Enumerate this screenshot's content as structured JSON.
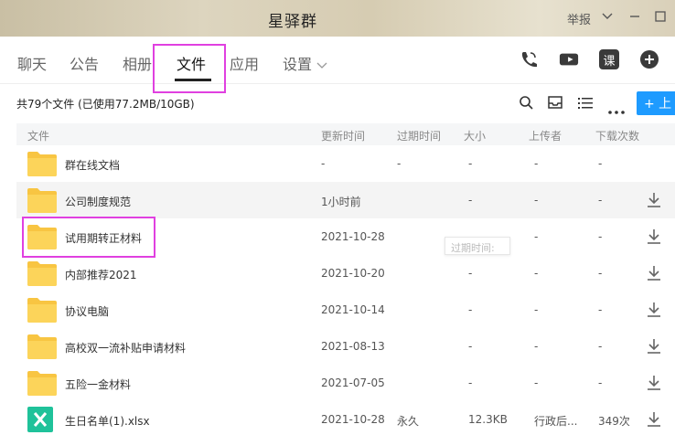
{
  "window": {
    "title": "星驿群",
    "report": "举报"
  },
  "tabs": [
    {
      "label": "聊天"
    },
    {
      "label": "公告"
    },
    {
      "label": "相册"
    },
    {
      "label": "文件"
    },
    {
      "label": "应用"
    },
    {
      "label": "设置"
    }
  ],
  "toolbar_icons": [
    "phone-icon",
    "video-icon",
    "lesson-icon",
    "add-circle-icon"
  ],
  "lesson_label": "课",
  "summary": "共79个文件 (已使用77.2MB/10GB)",
  "upload_label": "+ 上",
  "headers": {
    "name": "文件",
    "updated": "更新时间",
    "expire": "过期时间",
    "size": "大小",
    "uploader": "上传者",
    "downloads": "下载次数"
  },
  "rows": [
    {
      "name": "群在线文档",
      "updated": "-",
      "expire": "-",
      "size": "-",
      "uploader": "-",
      "downloads": "-",
      "type": "folder",
      "download": false
    },
    {
      "name": "公司制度规范",
      "updated": "1小时前",
      "expire": "",
      "size": "-",
      "uploader": "-",
      "downloads": "-",
      "type": "folder",
      "download": true
    },
    {
      "name": "试用期转正材料",
      "updated": "2021-10-28",
      "expire": "",
      "size": "-",
      "uploader": "-",
      "downloads": "-",
      "type": "folder",
      "download": true
    },
    {
      "name": "内部推荐2021",
      "updated": "2021-10-20",
      "expire": "",
      "size": "-",
      "uploader": "-",
      "downloads": "-",
      "type": "folder",
      "download": true
    },
    {
      "name": "协议电脑",
      "updated": "2021-10-14",
      "expire": "",
      "size": "-",
      "uploader": "-",
      "downloads": "-",
      "type": "folder",
      "download": true
    },
    {
      "name": "高校双一流补贴申请材料",
      "updated": "2021-08-13",
      "expire": "",
      "size": "-",
      "uploader": "-",
      "downloads": "-",
      "type": "folder",
      "download": true
    },
    {
      "name": "五险一金材料",
      "updated": "2021-07-05",
      "expire": "",
      "size": "-",
      "uploader": "-",
      "downloads": "-",
      "type": "folder",
      "download": true
    },
    {
      "name": "生日名单(1).xlsx",
      "updated": "2021-10-28",
      "expire": "永久",
      "size": "12.3KB",
      "uploader": "行政后...",
      "downloads": "349次",
      "type": "excel",
      "download": true
    }
  ],
  "tooltip": "过期时间:",
  "colors": {
    "accent": "#1e9bff",
    "highlight": "#e040e0",
    "folder": "#f8c542",
    "excel": "#1fc29a"
  }
}
